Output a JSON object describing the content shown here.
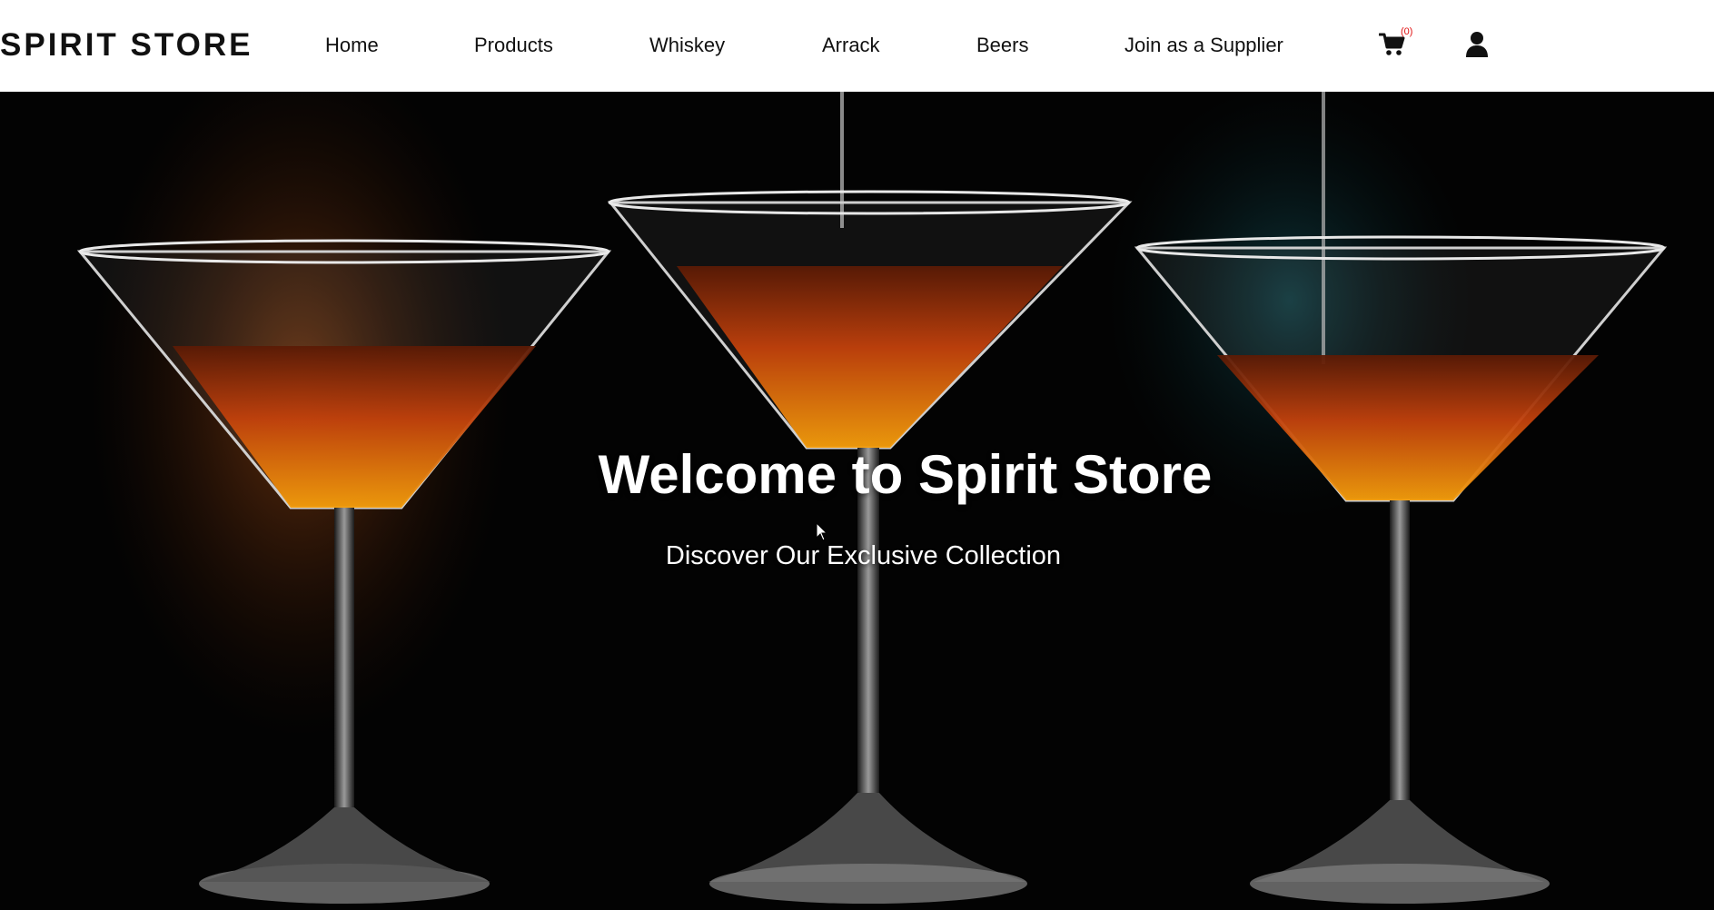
{
  "header": {
    "brand": "SPIRIT STORE",
    "nav": [
      {
        "label": "Home"
      },
      {
        "label": "Products"
      },
      {
        "label": "Whiskey"
      },
      {
        "label": "Arrack"
      },
      {
        "label": "Beers"
      },
      {
        "label": "Join as a Supplier"
      }
    ],
    "cart": {
      "icon": "shopping-cart-icon",
      "count_label": "(0)",
      "count_color": "#e01010"
    },
    "account": {
      "icon": "user-icon"
    }
  },
  "hero": {
    "title": "Welcome to Spirit Store",
    "subtitle": "Discover Our Exclusive Collection",
    "image": "three-cocktail-glasses-dark-background"
  },
  "theme": {
    "nav_background": "#ffffff",
    "nav_text": "#111111",
    "hero_text": "#ffffff",
    "hero_background": "#020202",
    "drink_color": "#c2410c"
  }
}
